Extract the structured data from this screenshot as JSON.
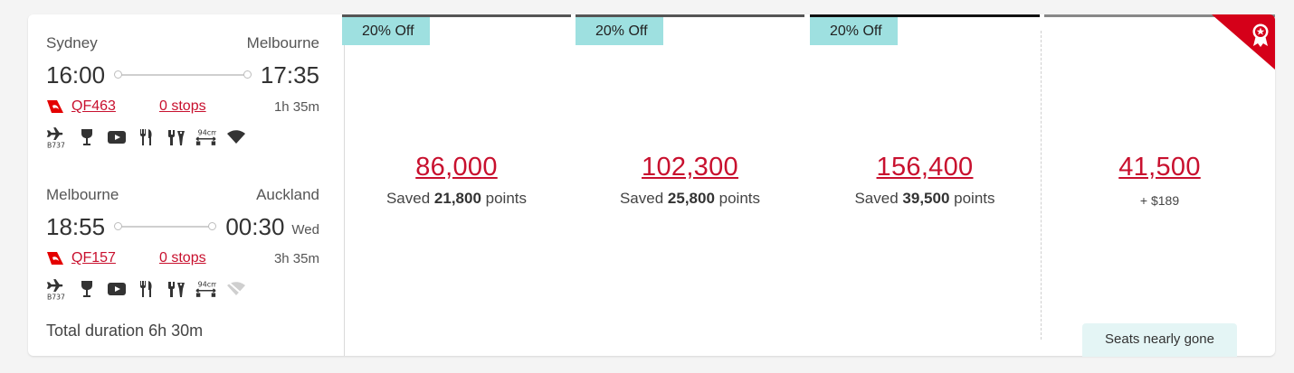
{
  "segments": [
    {
      "from_city": "Sydney",
      "to_city": "Melbourne",
      "depart": "16:00",
      "arrive": "17:35",
      "day_offset": "",
      "flight": "QF463",
      "stops": "0 stops",
      "duration": "1h 35m",
      "aircraft_label": "B737",
      "amenities": [
        "aircraft-b737",
        "wine-glass",
        "entertainment-screen",
        "meal-cutlery",
        "snacks",
        "seat-pitch-94cm",
        "wifi"
      ]
    },
    {
      "from_city": "Melbourne",
      "to_city": "Auckland",
      "depart": "18:55",
      "arrive": "00:30",
      "day_offset": "Wed",
      "flight": "QF157",
      "stops": "0 stops",
      "duration": "3h 35m",
      "aircraft_label": "B737",
      "amenities": [
        "aircraft-b737",
        "wine-glass",
        "entertainment-screen",
        "meal-cutlery",
        "snacks",
        "seat-pitch-94cm",
        "no-wifi"
      ]
    }
  ],
  "seat_pitch_label": "94cm",
  "total_duration": "Total duration 6h 30m",
  "fares": [
    {
      "badge": "20% Off",
      "points": "86,000",
      "saved_prefix": "Saved",
      "saved_points": "21,800",
      "saved_suffix": "points"
    },
    {
      "badge": "20% Off",
      "points": "102,300",
      "saved_prefix": "Saved",
      "saved_points": "25,800",
      "saved_suffix": "points"
    },
    {
      "badge": "20% Off",
      "points": "156,400",
      "saved_prefix": "Saved",
      "saved_points": "39,500",
      "saved_suffix": "points"
    },
    {
      "points": "41,500",
      "cash": "+ $189",
      "status": "Seats nearly gone",
      "corner_icon": "award-ribbon-icon"
    }
  ],
  "colors": {
    "brand_red": "#c8102e",
    "badge_teal": "#9ee0e0",
    "seats_bg": "#e4f5f5",
    "award_corner": "#d50019"
  }
}
